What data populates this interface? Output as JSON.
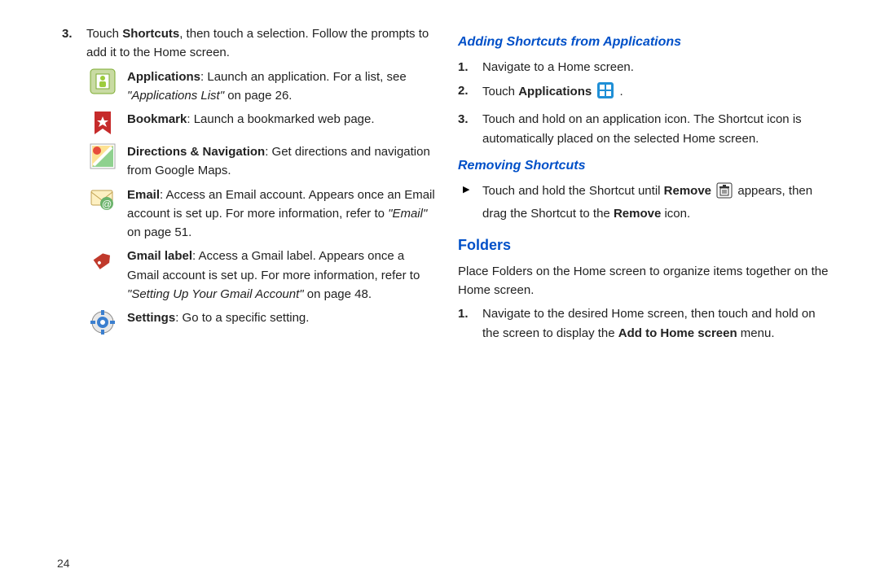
{
  "page_number": "24",
  "left": {
    "step3_prefix": "Touch ",
    "step3_bold": "Shortcuts",
    "step3_rest": ", then touch a selection. Follow the prompts to add it to the Home screen.",
    "items": [
      {
        "title": "Applications",
        "body1": ": Launch an application. For a list, see ",
        "link": "\"Applications List\"",
        "body2": " on page 26."
      },
      {
        "title": "Bookmark",
        "body1": ": Launch a bookmarked web page."
      },
      {
        "title": "Directions & Navigation",
        "body1": ": Get directions and navigation from Google Maps."
      },
      {
        "title": "Email",
        "body1": ": Access an Email account. Appears once an Email account is set up. For more information, refer to ",
        "link": "\"Email\"",
        "body2": "  on page 51."
      },
      {
        "title": "Gmail label",
        "body1": ": Access a Gmail label. Appears once a Gmail account is set up. For more information, refer to ",
        "link": "\"Setting Up Your Gmail Account\"",
        "body2": "  on page 48."
      },
      {
        "title": "Settings",
        "body1": ": Go to a specific setting."
      }
    ]
  },
  "right": {
    "h1": "Adding Shortcuts from Applications",
    "s1": "Navigate to a Home screen.",
    "s2a": "Touch ",
    "s2b": "Applications",
    "s2c": " .",
    "s3": "Touch and hold on an application icon. The Shortcut icon is automatically placed on the selected Home screen.",
    "h2": "Removing Shortcuts",
    "rem_a": "Touch and hold the Shortcut until ",
    "rem_b": "Remove",
    "rem_c": "  appears, then drag the Shortcut to the ",
    "rem_d": "Remove",
    "rem_e": " icon.",
    "h3": "Folders",
    "fold_intro": "Place Folders on the Home screen to organize items together on the Home screen.",
    "f1a": "Navigate to the desired Home screen, then touch and hold on the screen to display the ",
    "f1b": "Add to Home screen",
    "f1c": " menu."
  }
}
